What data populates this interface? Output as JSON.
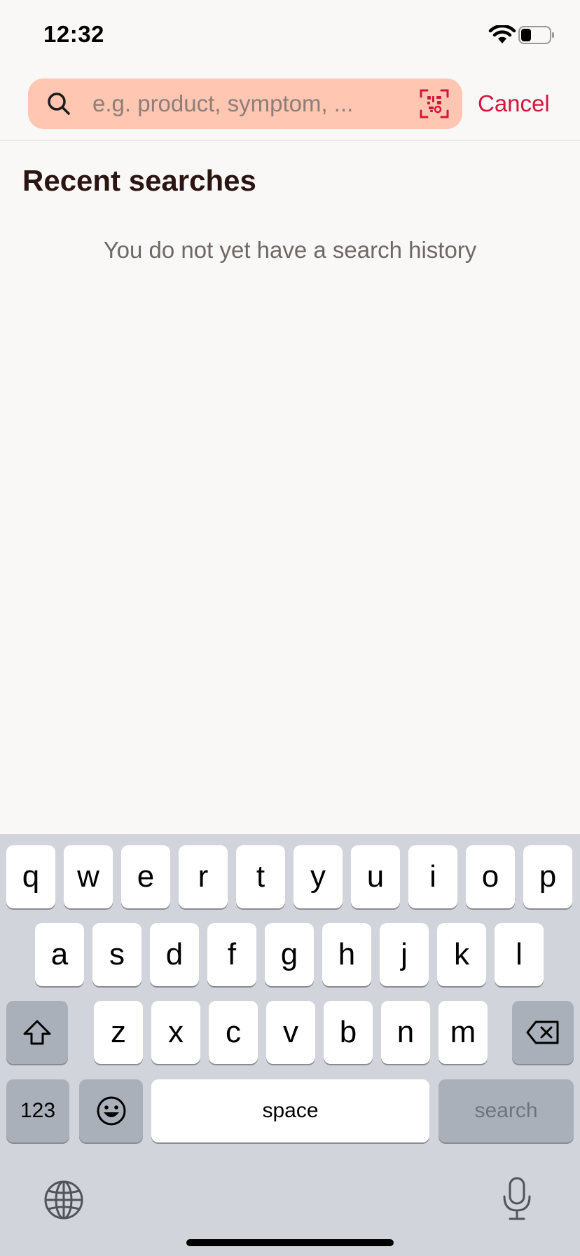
{
  "status_bar": {
    "time": "12:32",
    "battery_level": 0.35
  },
  "search": {
    "placeholder": "e.g. product, symptom, ...",
    "value": "",
    "cancel_label": "Cancel"
  },
  "colors": {
    "accent": "#d4163f",
    "search_bg": "#ffc6b2",
    "page_bg": "#faf8f7",
    "title": "#2a1512"
  },
  "recent": {
    "title": "Recent searches",
    "empty_message": "You do not yet have a search history"
  },
  "keyboard": {
    "row1": [
      "q",
      "w",
      "e",
      "r",
      "t",
      "y",
      "u",
      "i",
      "o",
      "p"
    ],
    "row2": [
      "a",
      "s",
      "d",
      "f",
      "g",
      "h",
      "j",
      "k",
      "l"
    ],
    "row3": [
      "z",
      "x",
      "c",
      "v",
      "b",
      "n",
      "m"
    ],
    "numbers_label": "123",
    "space_label": "space",
    "return_label": "search",
    "icons": [
      "shift-icon",
      "backspace-icon",
      "emoji-icon",
      "globe-icon",
      "microphone-icon"
    ]
  }
}
